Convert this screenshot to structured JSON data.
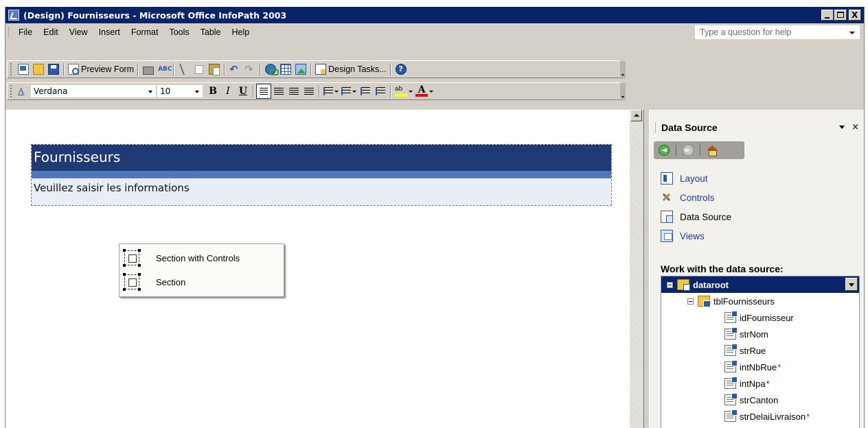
{
  "window": {
    "title": "(Design) Fournisseurs - Microsoft Office InfoPath 2003",
    "close_glyph": "X"
  },
  "menubar": {
    "items": [
      {
        "label": "File"
      },
      {
        "label": "Edit"
      },
      {
        "label": "View"
      },
      {
        "label": "Insert"
      },
      {
        "label": "Format"
      },
      {
        "label": "Tools"
      },
      {
        "label": "Table"
      },
      {
        "label": "Help"
      }
    ],
    "help_placeholder": "Type a question for help"
  },
  "standard_toolbar": {
    "preview_label": "Preview Form",
    "design_tasks_label": "Design Tasks...",
    "spell_glyph": "ABC",
    "undo_glyph": "↶",
    "redo_glyph": "↷",
    "help_glyph": "?"
  },
  "formatting_toolbar": {
    "font_icon_glyph": "A",
    "font_name": "Verdana",
    "font_size": "10",
    "bold_glyph": "B",
    "italic_glyph": "I",
    "underline_glyph": "U",
    "highlight_glyph": "ab",
    "font_color_glyph": "A"
  },
  "form": {
    "title": "Fournisseurs",
    "subtitle": "Veuillez saisir les informations",
    "colors": {
      "title_band": "#1f3a75",
      "stripe": "#4f78b8",
      "sub_band": "#e8eef8"
    }
  },
  "context_menu": {
    "items": [
      {
        "label": "Section with Controls",
        "icon": "section-icon"
      },
      {
        "label": "Section",
        "icon": "section-icon"
      }
    ]
  },
  "task_pane": {
    "title": "Data Source",
    "close_glyph": "×",
    "nav_back_glyph": "◄",
    "nav_forward_glyph": "►",
    "links": [
      {
        "label": "Layout",
        "icon": "layout-icon"
      },
      {
        "label": "Controls",
        "icon": "controls-icon"
      },
      {
        "label": "Data Source",
        "icon": "data-source-icon"
      },
      {
        "label": "Views",
        "icon": "views-icon"
      }
    ],
    "work_label": "Work with the data source:",
    "tree": {
      "root": "dataroot",
      "group": "tblFournisseurs",
      "fields": [
        {
          "name": "idFournisseur",
          "required": false
        },
        {
          "name": "strNom",
          "required": false
        },
        {
          "name": "strRue",
          "required": false
        },
        {
          "name": "intNbRue",
          "required": true
        },
        {
          "name": "intNpa",
          "required": true
        },
        {
          "name": "strCanton",
          "required": false
        },
        {
          "name": "strDelaiLivraison",
          "required": true
        }
      ],
      "required_marker": "*"
    }
  }
}
